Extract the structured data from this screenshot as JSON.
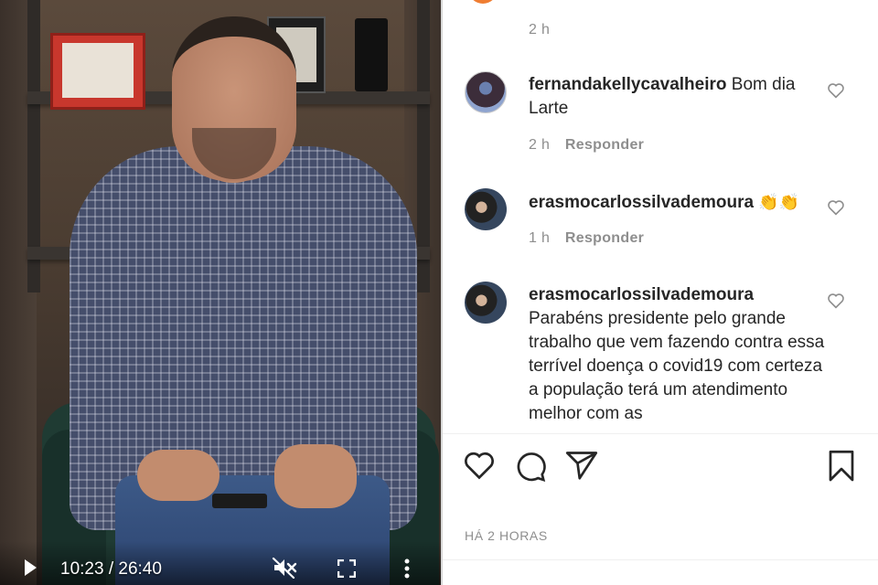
{
  "video": {
    "time_display": "10:23 / 26:40",
    "icons": {
      "play": "play-icon",
      "mute": "muted-speaker-icon",
      "fullscreen": "fullscreen-icon",
      "more": "more-vertical-icon"
    }
  },
  "feed": {
    "top_meta_time": "2 h",
    "comments": [
      {
        "username": "fernandakellycavalheiro",
        "text": "Bom dia Larte",
        "time": "2 h",
        "reply_label": "Responder"
      },
      {
        "username": "erasmocarlossilvademoura",
        "text": "👏👏",
        "time": "1 h",
        "reply_label": "Responder"
      },
      {
        "username": "erasmocarlossilvademoura",
        "text": "Parabéns presidente pelo grande trabalho que vem fazendo contra essa terrível doença o covid19 com certeza a população terá um atendimento melhor com as"
      }
    ],
    "timestamp": "HÁ 2 HORAS"
  },
  "colors": {
    "text_primary": "#262626",
    "text_secondary": "#8e8e8e",
    "divider": "#efefef"
  }
}
